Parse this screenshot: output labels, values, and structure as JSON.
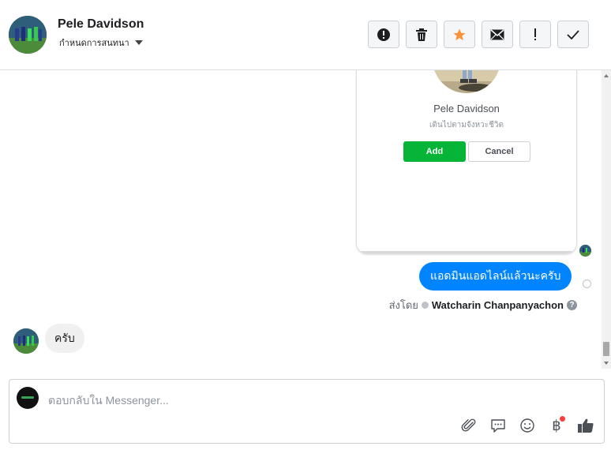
{
  "header": {
    "contact_name": "Pele Davidson",
    "label_menu": "กำหนดการสนทนา",
    "actions": [
      {
        "name": "spam-button",
        "icon": "alert-circle-icon"
      },
      {
        "name": "delete-button",
        "icon": "trash-icon"
      },
      {
        "name": "star-button",
        "icon": "star-icon",
        "color": "#f7923a"
      },
      {
        "name": "mark-unread-button",
        "icon": "envelope-icon"
      },
      {
        "name": "follow-up-button",
        "icon": "exclamation-icon"
      },
      {
        "name": "mark-done-button",
        "icon": "check-icon"
      }
    ]
  },
  "conversation": {
    "profile_card": {
      "name": "Pele Davidson",
      "status": "เดินไปตามจังหวะชีวิต",
      "add_label": "Add",
      "cancel_label": "Cancel"
    },
    "outgoing_message": "แอดมินแอดไลน์แล้วนะครับ",
    "sent_by_prefix": "ส่งโดย",
    "sent_by_name": "Watcharin Chanpanyachon",
    "help_glyph": "?",
    "incoming_message": "ครับ"
  },
  "composer": {
    "placeholder": "ตอบกลับใน Messenger...",
    "baht_glyph": "฿",
    "tools": [
      "paperclip-icon",
      "saved-reply-icon",
      "emoji-icon",
      "payment-icon",
      "like-icon"
    ]
  },
  "colors": {
    "outgoing_bubble": "#0084ff",
    "add_button": "#06b537",
    "notification_dot": "#fa3e3e",
    "star": "#f7923a"
  }
}
